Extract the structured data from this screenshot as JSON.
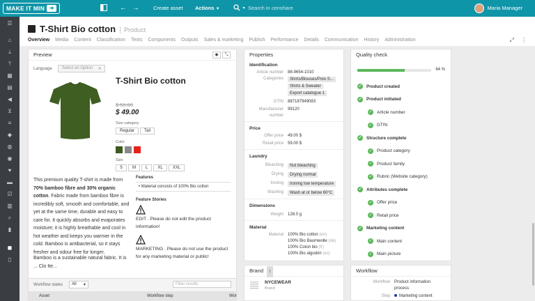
{
  "topbar": {
    "logo": "MAKE IT MIN",
    "create_asset": "Create asset",
    "actions": "Actions",
    "search_placeholder": "Search in censhare",
    "user_name": "Maria Manager"
  },
  "header": {
    "title": "T-Shirt Bio cotton",
    "type": "Product",
    "tabs": [
      "Overview",
      "Media",
      "Content",
      "Classification",
      "Texts",
      "Components",
      "Outputs",
      "Sales & marketing",
      "Publish",
      "Performance",
      "Details",
      "Communication",
      "History",
      "Administration"
    ]
  },
  "preview": {
    "title": "Preview",
    "language_label": "Language",
    "language_placeholder": "Select an Option",
    "product_title": "T-Shirt Bio cotton",
    "old_price": "$ 59.00",
    "price": "$ 49.00",
    "size_category_label": "Size category",
    "size_categories": [
      "Regular",
      "Tall"
    ],
    "color_label": "Color",
    "colors": [
      "#3d5a1f",
      "#8a8a8a",
      "#e5231b"
    ],
    "size_label": "Size",
    "sizes": [
      "S",
      "M",
      "L",
      "XL",
      "XXL"
    ],
    "desc_intro": "This premium quality T-shirt is made from ",
    "desc_bold": "70% bamboo fibre and 30% organic cotton",
    "desc_rest": ". Fabric made from bamboo fibre is incredibly soft, smooth and comfortable, and yet at the same time, durable and easy to care for. It quickly absorbs and evaporates moisture; it is highly breathable and cool in hot weather and keeps you warmer in the cold. Bamboo is antibacterial, so it stays fresher and odour free for longer.",
    "desc_2": "Bamboo is a sustainable natural fabric. It is ... Clo Ite...",
    "features_title": "Features",
    "feature_item": "Material consists of 100% Bio cotton",
    "feature_stories_title": "Feature Stories",
    "story_1": "EDIT . Please do not edit the product information!",
    "story_2": "MARKETING . Please do not use the product for any marketing material or public!",
    "workflow_states_label": "Workflow states",
    "workflow_filter_value": "All",
    "filter_placeholder": "Filter results",
    "col_asset": "Asset",
    "col_workflow_step": "Workflow step",
    "col_wor": "Wor"
  },
  "properties": {
    "title": "Properties",
    "identification_title": "Identification",
    "article_number_label": "Article number",
    "article_number": "88-9654-1010",
    "categories_label": "Categories",
    "categories": [
      "Shirts/Blouses/Polo S...",
      "Shirts & Sweater",
      "Export catalogue 1"
    ],
    "gtin_label": "GTIN",
    "gtin": "887187949083",
    "manufacturer_label": "Manufacturer number",
    "manufacturer": "99120",
    "price_title": "Price",
    "offer_price_label": "Offer price",
    "offer_price": "49.00 $",
    "retail_price_label": "Retail price",
    "retail_price": "59.00 $",
    "laundry_title": "Laundry",
    "bleaching_label": "Bleaching",
    "bleaching": "Not bleaching",
    "drying_label": "Drying",
    "drying": "Drying normal",
    "ironing_label": "Ironing",
    "ironing": "Ironing low temperature",
    "washing_label": "Washing",
    "washing": "Wash at or below 60°C",
    "dimensions_title": "Dimensions",
    "weight_label": "Weight",
    "weight": "128.0 g",
    "material_title": "Material",
    "material_label": "Material",
    "materials": [
      {
        "name": "100% Bio cotton",
        "lang": "(en)"
      },
      {
        "name": "100% Bio Baumwolle",
        "lang": "(de)"
      },
      {
        "name": "100% Coton bio",
        "lang": "(fr)"
      },
      {
        "name": "100% Bio algodón",
        "lang": "(es)"
      }
    ]
  },
  "brand": {
    "title": "Brand",
    "count": "1",
    "name": "NYCEWEAR",
    "sub": "Brand"
  },
  "quality": {
    "title": "Quality check",
    "percent_label": "64 %",
    "percent": 64,
    "items": [
      {
        "label": "Product created",
        "level": "main"
      },
      {
        "label": "Product initiated",
        "level": "main"
      },
      {
        "label": "Article number",
        "level": "sub"
      },
      {
        "label": "GTIN",
        "level": "sub"
      },
      {
        "label": "Structure complete",
        "level": "main"
      },
      {
        "label": "Product category",
        "level": "sub"
      },
      {
        "label": "Product family",
        "level": "sub"
      },
      {
        "label": "Rubric (Website category)",
        "level": "sub"
      },
      {
        "label": "Attributes complete",
        "level": "main"
      },
      {
        "label": "Offer price",
        "level": "sub"
      },
      {
        "label": "Retail price",
        "level": "sub"
      },
      {
        "label": "Marketing content",
        "level": "main"
      },
      {
        "label": "Main content",
        "level": "sub"
      },
      {
        "label": "Main picture",
        "level": "sub"
      }
    ]
  },
  "workflow": {
    "title": "Workflow",
    "workflow_label": "Workflow",
    "workflow_value": "Product information process",
    "step_label": "Step",
    "step_value": "Marketing content"
  }
}
